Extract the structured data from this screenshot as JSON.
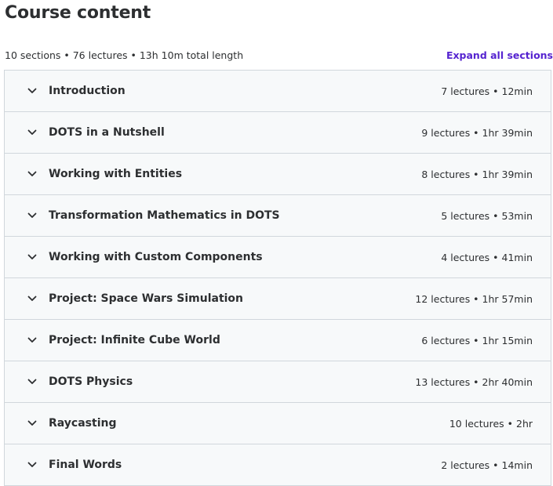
{
  "header": {
    "title": "Course content",
    "summary": "10 sections • 76 lectures • 13h 10m total length",
    "expand_label": "Expand all sections"
  },
  "colors": {
    "link": "#5624d0",
    "text": "#2d2f31",
    "panel_bg": "#f7f9fa",
    "border": "#d1d7dc"
  },
  "sections": [
    {
      "title": "Introduction",
      "meta": "7 lectures • 12min"
    },
    {
      "title": "DOTS in a Nutshell",
      "meta": "9 lectures • 1hr 39min"
    },
    {
      "title": "Working with Entities",
      "meta": "8 lectures • 1hr 39min"
    },
    {
      "title": "Transformation Mathematics in DOTS",
      "meta": "5 lectures • 53min"
    },
    {
      "title": "Working with Custom Components",
      "meta": "4 lectures • 41min"
    },
    {
      "title": "Project: Space Wars Simulation",
      "meta": "12 lectures • 1hr 57min"
    },
    {
      "title": "Project: Infinite Cube World",
      "meta": "6 lectures • 1hr 15min"
    },
    {
      "title": "DOTS Physics",
      "meta": "13 lectures • 2hr 40min"
    },
    {
      "title": "Raycasting",
      "meta": "10 lectures • 2hr"
    },
    {
      "title": "Final Words",
      "meta": "2 lectures • 14min"
    }
  ],
  "icons": {
    "section_toggle": "chevron-down-icon"
  }
}
